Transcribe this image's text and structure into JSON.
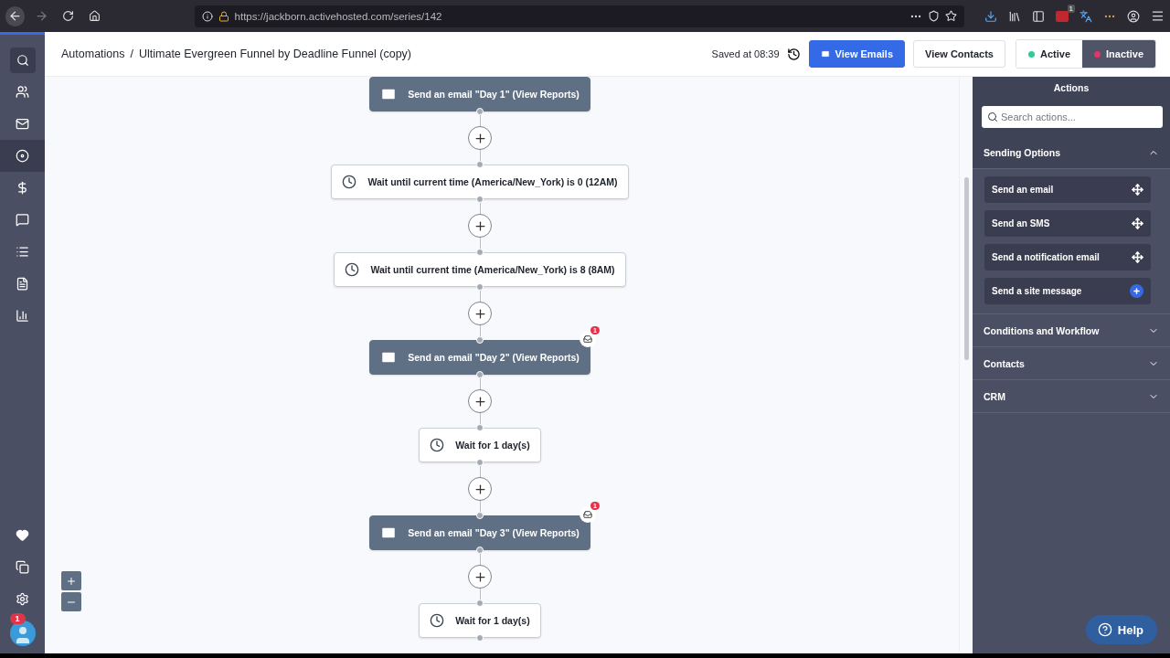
{
  "browser": {
    "url": "https://jackborn.activehosted.com/series/142",
    "extension_badge": "1"
  },
  "sidebar": {
    "items": [
      {
        "selected": false
      },
      {
        "selected": false
      },
      {
        "selected": false
      },
      {
        "selected": true
      },
      {
        "selected": false
      },
      {
        "selected": false
      },
      {
        "selected": false
      },
      {
        "selected": false
      },
      {
        "selected": false
      }
    ],
    "notification_count": "1"
  },
  "header": {
    "breadcrumb": "Automations",
    "separator": "/",
    "title": "Ultimate Evergreen Funnel by Deadline Funnel (copy)",
    "saved": "Saved at 08:39",
    "buttons": [
      {
        "kind": "primary",
        "label": "View Emails"
      },
      {
        "kind": "plain",
        "label": "View Contacts"
      }
    ],
    "status": [
      {
        "label": "Active",
        "color": "#2ecc9a",
        "selected": false
      },
      {
        "label": "Inactive",
        "color": "#e8336a",
        "selected": true
      }
    ]
  },
  "flow": {
    "steps": [
      {
        "kind": "email",
        "label": "Send an email \"Day 1\" (View Reports)"
      },
      {
        "kind": "wait",
        "label": "Wait until current time (America/New_York) is 0 (12AM)"
      },
      {
        "kind": "wait",
        "label": "Wait until current time (America/New_York) is 8 (8AM)"
      },
      {
        "kind": "email",
        "label": "Send an email \"Day 2\" (View Reports)",
        "badge": "1"
      },
      {
        "kind": "wait",
        "label": "Wait for 1 day(s)"
      },
      {
        "kind": "email",
        "label": "Send an email \"Day 3\" (View Reports)",
        "badge": "1"
      },
      {
        "kind": "wait",
        "label": "Wait for 1 day(s)"
      }
    ]
  },
  "actions": {
    "title": "Actions",
    "search": {
      "placeholder": "Search actions..."
    },
    "sections": [
      {
        "title": "Sending Options",
        "expanded": true,
        "items": [
          {
            "label": "Send an email",
            "kind": "drag"
          },
          {
            "label": "Send an SMS",
            "kind": "drag"
          },
          {
            "label": "Send a notification email",
            "kind": "drag"
          },
          {
            "label": "Send a site message",
            "kind": "add"
          }
        ]
      },
      {
        "title": "Conditions and Workflow",
        "expanded": false
      },
      {
        "title": "Contacts",
        "expanded": false
      },
      {
        "title": "CRM",
        "expanded": false
      }
    ]
  },
  "help": {
    "label": "Help"
  }
}
